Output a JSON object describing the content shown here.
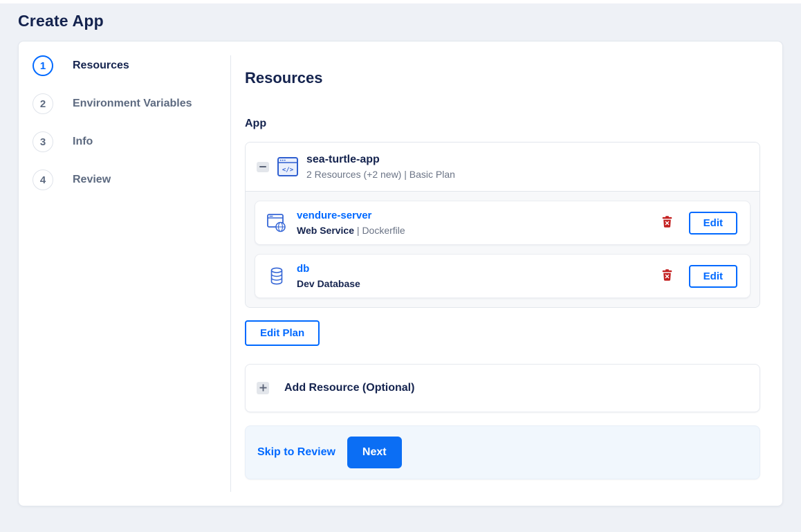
{
  "page": {
    "title": "Create App"
  },
  "stepper": {
    "steps": [
      {
        "number": "1",
        "label": "Resources"
      },
      {
        "number": "2",
        "label": "Environment Variables"
      },
      {
        "number": "3",
        "label": "Info"
      },
      {
        "number": "4",
        "label": "Review"
      }
    ],
    "active_step": "1"
  },
  "main": {
    "heading": "Resources",
    "app_section_label": "App",
    "app_group": {
      "name": "sea-turtle-app",
      "summary": "2 Resources (+2 new) | Basic Plan",
      "resources": [
        {
          "name": "vendure-server",
          "type": "Web Service",
          "separator": " | ",
          "detail": "Dockerfile",
          "edit_label": "Edit"
        },
        {
          "name": "db",
          "type": "Dev Database",
          "separator": "",
          "detail": "",
          "edit_label": "Edit"
        }
      ]
    },
    "edit_plan_label": "Edit Plan",
    "add_resource_label": "Add Resource (Optional)",
    "footer": {
      "skip_label": "Skip to Review",
      "next_label": "Next"
    }
  },
  "icons": {
    "collapse": "minus-icon",
    "expand": "plus-icon",
    "app": "app-window-code-icon",
    "web_service": "web-service-globe-icon",
    "database": "database-cylinder-icon",
    "delete": "trash-icon"
  },
  "colors": {
    "accent": "#0069ff",
    "danger": "#c32020",
    "heading_text": "#14234e",
    "muted_text": "#6b7486",
    "page_bg": "#eef1f6",
    "card_border": "#e3e7ee",
    "group_body_bg": "#f7f8fa",
    "footer_bg": "#f1f7fd"
  }
}
